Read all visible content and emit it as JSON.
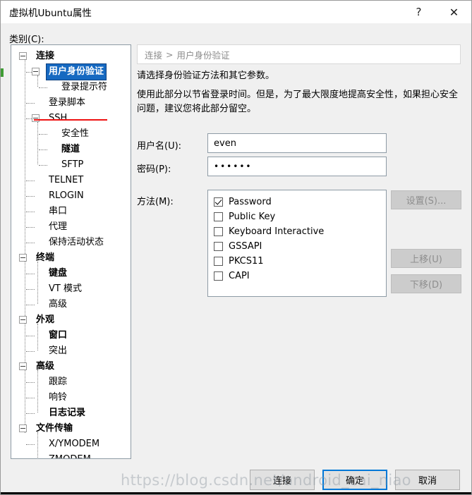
{
  "window": {
    "title": "虚拟机Ubuntu属性",
    "help_icon": "?",
    "close_icon": "✕"
  },
  "category": {
    "label": "类别(C):"
  },
  "tree": {
    "nodes": [
      {
        "label": "连接",
        "depth": 0,
        "bold": true,
        "expander": true,
        "selected": false
      },
      {
        "label": "用户身份验证",
        "depth": 1,
        "bold": true,
        "expander": true,
        "selected": true
      },
      {
        "label": "登录提示符",
        "depth": 2,
        "bold": false,
        "expander": false,
        "selected": false
      },
      {
        "label": "登录脚本",
        "depth": 1,
        "bold": false,
        "expander": false,
        "selected": false
      },
      {
        "label": "SSH",
        "depth": 1,
        "bold": false,
        "expander": true,
        "selected": false
      },
      {
        "label": "安全性",
        "depth": 2,
        "bold": false,
        "expander": false,
        "selected": false
      },
      {
        "label": "隧道",
        "depth": 2,
        "bold": true,
        "expander": false,
        "selected": false
      },
      {
        "label": "SFTP",
        "depth": 2,
        "bold": false,
        "expander": false,
        "selected": false
      },
      {
        "label": "TELNET",
        "depth": 1,
        "bold": false,
        "expander": false,
        "selected": false
      },
      {
        "label": "RLOGIN",
        "depth": 1,
        "bold": false,
        "expander": false,
        "selected": false
      },
      {
        "label": "串口",
        "depth": 1,
        "bold": false,
        "expander": false,
        "selected": false
      },
      {
        "label": "代理",
        "depth": 1,
        "bold": false,
        "expander": false,
        "selected": false
      },
      {
        "label": "保持活动状态",
        "depth": 1,
        "bold": false,
        "expander": false,
        "selected": false
      },
      {
        "label": "终端",
        "depth": 0,
        "bold": true,
        "expander": true,
        "selected": false
      },
      {
        "label": "键盘",
        "depth": 1,
        "bold": true,
        "expander": false,
        "selected": false
      },
      {
        "label": "VT 模式",
        "depth": 1,
        "bold": false,
        "expander": false,
        "selected": false
      },
      {
        "label": "高级",
        "depth": 1,
        "bold": false,
        "expander": false,
        "selected": false
      },
      {
        "label": "外观",
        "depth": 0,
        "bold": true,
        "expander": true,
        "selected": false
      },
      {
        "label": "窗口",
        "depth": 1,
        "bold": true,
        "expander": false,
        "selected": false
      },
      {
        "label": "突出",
        "depth": 1,
        "bold": false,
        "expander": false,
        "selected": false
      },
      {
        "label": "高级",
        "depth": 0,
        "bold": true,
        "expander": true,
        "selected": false
      },
      {
        "label": "跟踪",
        "depth": 1,
        "bold": false,
        "expander": false,
        "selected": false
      },
      {
        "label": "响铃",
        "depth": 1,
        "bold": false,
        "expander": false,
        "selected": false
      },
      {
        "label": "日志记录",
        "depth": 1,
        "bold": true,
        "expander": false,
        "selected": false
      },
      {
        "label": "文件传输",
        "depth": 0,
        "bold": true,
        "expander": true,
        "selected": false
      },
      {
        "label": "X/YMODEM",
        "depth": 1,
        "bold": false,
        "expander": false,
        "selected": false
      },
      {
        "label": "ZMODEM",
        "depth": 1,
        "bold": false,
        "expander": false,
        "selected": false
      }
    ]
  },
  "content": {
    "breadcrumb_parent": "连接",
    "breadcrumb_sep": ">",
    "breadcrumb_current": "用户身份验证",
    "description_line1": "请选择身份验证方法和其它参数。",
    "description_line2": "使用此部分以节省登录时间。但是，为了最大限度地提高安全性，如果担心安全问题，建议您将此部分留空。",
    "username_label": "用户名(U):",
    "username_value": "even",
    "password_label": "密码(P):",
    "password_value": "••••••",
    "methods_label": "方法(M):",
    "methods": [
      {
        "label": "Password",
        "checked": true
      },
      {
        "label": "Public Key",
        "checked": false
      },
      {
        "label": "Keyboard Interactive",
        "checked": false
      },
      {
        "label": "GSSAPI",
        "checked": false
      },
      {
        "label": "PKCS11",
        "checked": false
      },
      {
        "label": "CAPI",
        "checked": false
      }
    ],
    "settings_button": "设置(S)...",
    "move_up_button": "上移(U)",
    "move_down_button": "下移(D)"
  },
  "footer": {
    "connect_button": "连接",
    "ok_button": "确定",
    "cancel_button": "取消"
  },
  "watermark": {
    "text": "https://blog.csdn.net/android_cai_niao"
  },
  "colors": {
    "selection_blue": "#1669c1",
    "focus_blue": "#0078d7",
    "annotation_red": "#ee1111",
    "dialog_bg": "#f0f0f0",
    "disabled_button": "#cccccc"
  }
}
